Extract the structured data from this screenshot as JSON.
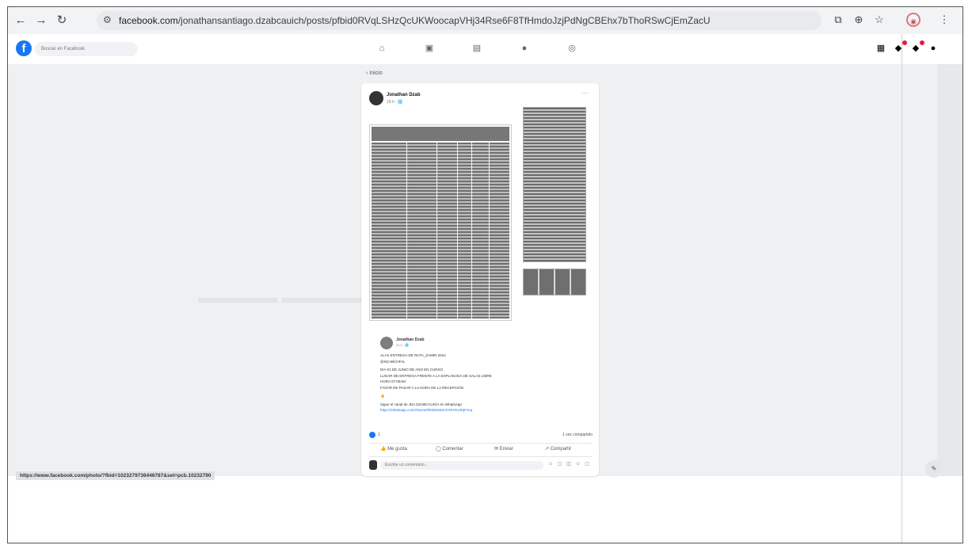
{
  "browser": {
    "url_host": "facebook.com",
    "url_path": "/jonathansantiago.dzabcauich/posts/pfbid0RVqLSHzQcUKWoocapVHj34Rse6F8TfHmdoJzjPdNgCBEhx7bThoRSwCjEmZacU"
  },
  "facebook": {
    "logo": "f",
    "search_placeholder": "Buscar en Facebook"
  },
  "post": {
    "back_label": "‹ Inicio",
    "author": "Jonathan Dzab",
    "time": "19 h · 🌐",
    "more": "···",
    "shared": {
      "author": "Jonathan Dzab",
      "time": "21 h · 🌐",
      "lines": [
        "ALAS ENTREGA DE RUTA_ZAMIR 2024",
        "@NCABCHFAL",
        "DIA 01 DE JUNIO DE ANO EN CURSO",
        "LUGAR DE ENTREGA FRENTE A LA EXPLANADA DE SALAS LIBRE",
        "HORA 07:00AM",
        "FAVOR DE PASAR A LA HORA DE LA RECEPCION",
        "👍",
        "Sigue el canal de JDA DZABCAUICH en WhatsApp:"
      ],
      "link": "https://whatsapp.com/channel/0029VaHeJYEHXU3HjF4vq"
    },
    "reaction_count": "1",
    "shares": "1 vez compartido",
    "actions": {
      "like": "Me gusta",
      "comment": "Comentar",
      "send": "Enviar",
      "share": "Compartir"
    },
    "comment_placeholder": "Escribe un comentario...",
    "comment_icons": "☺ ▢ ◫ ☺ ▢"
  },
  "status_url": "https://www.facebook.com/photo/?fbid=1023279736446787&set=pcb.10232790"
}
